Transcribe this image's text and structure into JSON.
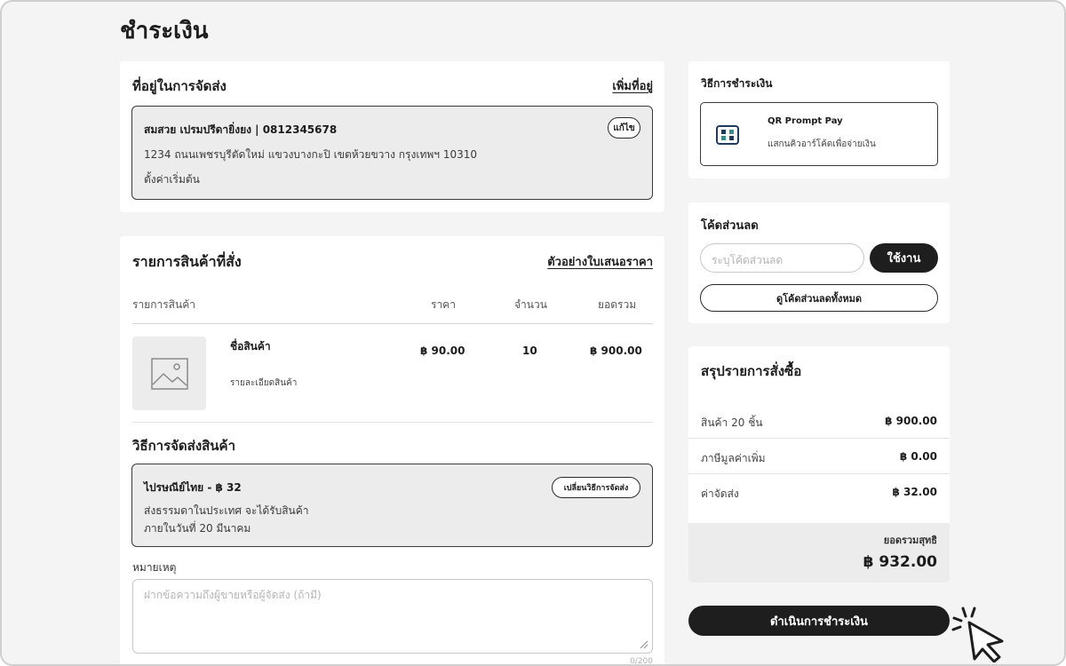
{
  "page": {
    "title": "ชำระเงิน"
  },
  "address": {
    "title": "ที่อยู่ในการจัดส่ง",
    "add_link": "เพิ่มที่อยู่",
    "name_phone": "สมสวย เปรมปรีดายิ่งยง | 0812345678",
    "line": "1234 ถนนเพชรบุรีตัดใหม่ แขวงบางกะปิ เขตห้วยขวาง กรุงเทพฯ 10310",
    "default_label": "ตั้งค่าเริ่มต้น",
    "edit_label": "แก้ไข"
  },
  "items": {
    "title": "รายการสินค้าที่สั่ง",
    "quote_link": "ตัวอย่างใบเสนอราคา",
    "headers": {
      "product": "รายการสินค้า",
      "price": "ราคา",
      "qty": "จำนวน",
      "total": "ยอดรวม"
    },
    "rows": [
      {
        "name": "ชื่อสินค้า",
        "detail": "รายละเอียดสินค้า",
        "price": "฿ 90.00",
        "qty": "10",
        "total": "฿ 900.00"
      }
    ]
  },
  "shipping": {
    "title": "วิธีการจัดส่งสินค้า",
    "option_title": "ไปรษณีย์ไทย - ฿ 32",
    "option_line1": "ส่งธรรมดาในประเทศ จะได้รับสินค้า",
    "option_line2": "ภายในวันที่ 20 มีนาคม",
    "change_label": "เปลี่ยนวิธีการจัดส่ง"
  },
  "note": {
    "label": "หมายเหตุ",
    "placeholder": "ฝากข้อความถึงผู้ขายหรือผู้จัดส่ง (ถ้ามี)",
    "counter": "0/200"
  },
  "payment": {
    "title": "วิธีการชำระเงิน",
    "method_title": "QR Prompt Pay",
    "method_desc": "แสกนคิวอาร์โค้ดเพื่อจ่ายเงิน"
  },
  "discount": {
    "title": "โค้ดส่วนลด",
    "placeholder": "ระบุโค้ดส่วนลด",
    "apply_label": "ใช้งาน",
    "view_all_label": "ดูโค้ดส่วนลดทั้งหมด"
  },
  "summary": {
    "title": "สรุปรายการสั่งซื้อ",
    "rows": [
      {
        "label": "สินค้า 20 ชิ้น",
        "value": "฿ 900.00"
      },
      {
        "label": "ภาษีมูลค่าเพิ่ม",
        "value": "฿ 0.00"
      },
      {
        "label": "ค่าจัดส่ง",
        "value": "฿ 32.00"
      }
    ],
    "net_label": "ยอดรวมสุทธิ",
    "net_value": "฿ 932.00"
  },
  "checkout": {
    "label": "ดำเนินการชำระเงิน"
  },
  "colors": {
    "accent": "#1e1e1e",
    "background": "#f4f4f4",
    "card": "#ffffff",
    "box": "#ececec"
  },
  "icons": [
    "image-placeholder-icon",
    "qr-code-icon",
    "resize-handle-icon",
    "cursor-click-icon"
  ]
}
